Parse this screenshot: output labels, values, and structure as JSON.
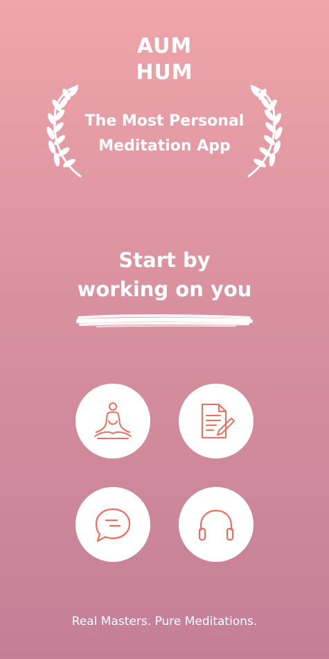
{
  "app": {
    "logo_lines": [
      "AUM",
      "HUM"
    ],
    "tagline_lines": [
      "The Most Personal",
      "Meditation App"
    ],
    "headline_lines": [
      "Start by",
      "working on you"
    ],
    "footer": "Real Masters. Pure Meditations."
  },
  "features": [
    {
      "icon": "meditation-pose-icon"
    },
    {
      "icon": "document-edit-icon"
    },
    {
      "icon": "chat-bubble-icon"
    },
    {
      "icon": "headphones-icon"
    }
  ],
  "colors": {
    "gradient_top": "#EFA5A9",
    "gradient_bottom": "#C47F97",
    "icon_accent": "#F26B5B",
    "text": "#FFFFFF"
  }
}
